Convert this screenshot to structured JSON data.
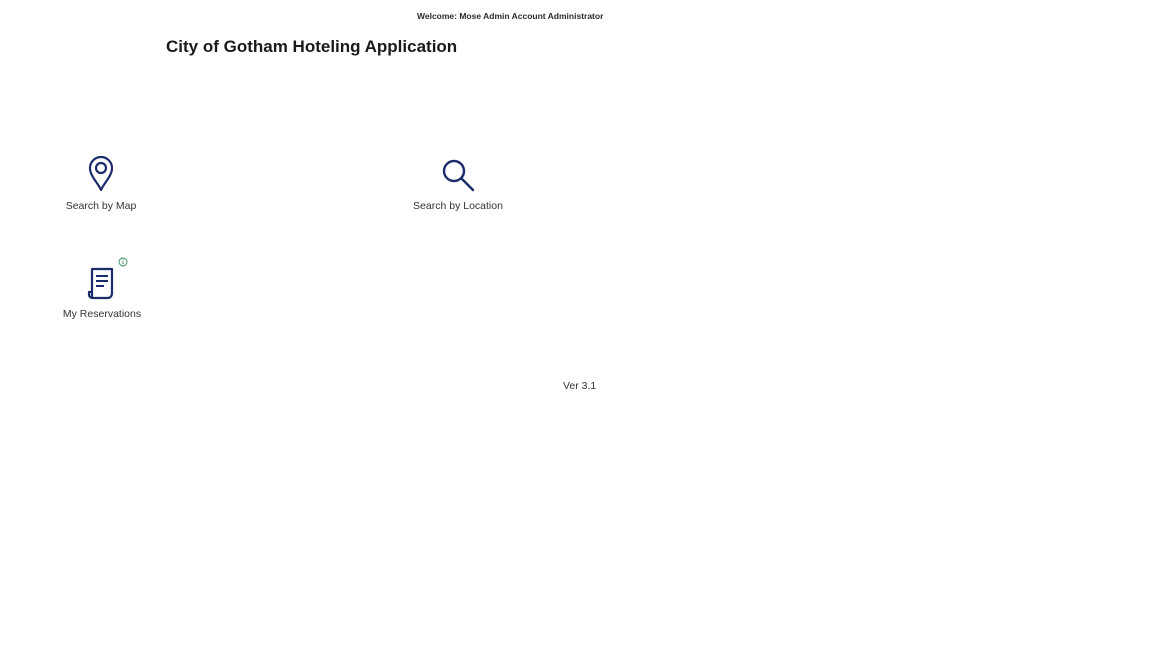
{
  "header": {
    "welcome_text": "Welcome: Mose Admin Account Administrator",
    "app_title": "City of Gotham Hoteling Application"
  },
  "tiles": [
    {
      "label": "Search by Map",
      "icon": "map-pin-icon"
    },
    {
      "label": "Search by Location",
      "icon": "search-icon"
    },
    {
      "label": "My Reservations",
      "icon": "receipt-icon",
      "badge_icon": "info-icon"
    }
  ],
  "footer": {
    "version": "Ver 3.1"
  },
  "colors": {
    "icon": "#1c2b6b",
    "badge": "#2e8b57",
    "text": "#333333"
  }
}
